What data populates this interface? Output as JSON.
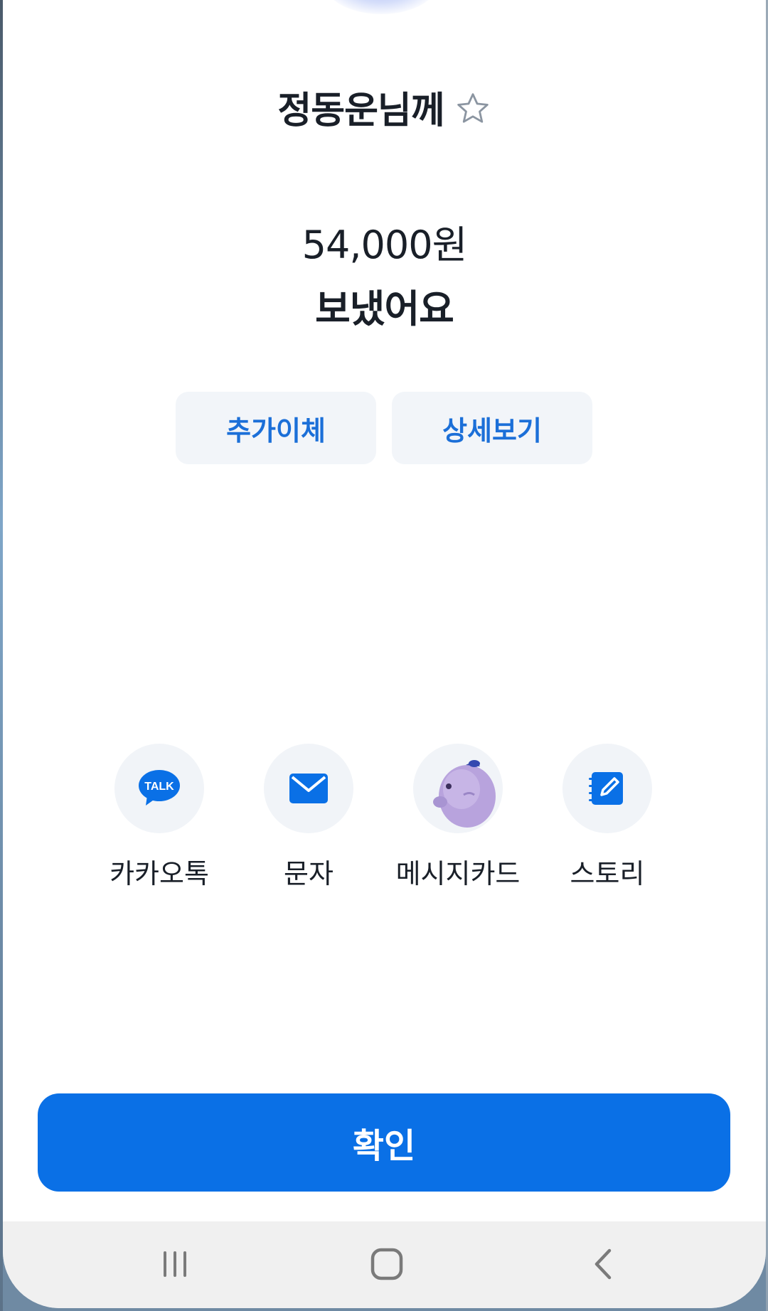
{
  "transfer": {
    "recipient_label": "정동운님께",
    "amount": "54,000원",
    "status_text": "보냈어요"
  },
  "actions": {
    "additional_transfer": "추가이체",
    "view_details": "상세보기"
  },
  "share_options": [
    {
      "label": "카카오톡",
      "icon": "kakaotalk-icon"
    },
    {
      "label": "문자",
      "icon": "message-mail-icon"
    },
    {
      "label": "메시지카드",
      "icon": "character-card-icon"
    },
    {
      "label": "스토리",
      "icon": "story-edit-icon"
    }
  ],
  "confirm_button": "확인",
  "kakao_badge": "TALK",
  "colors": {
    "accent_blue": "#0a70e6",
    "text_dark": "#191f28",
    "chip_bg": "#f2f5f9",
    "link_blue": "#1b6fd8"
  },
  "nav": [
    "recent-apps-icon",
    "home-icon",
    "back-icon"
  ]
}
